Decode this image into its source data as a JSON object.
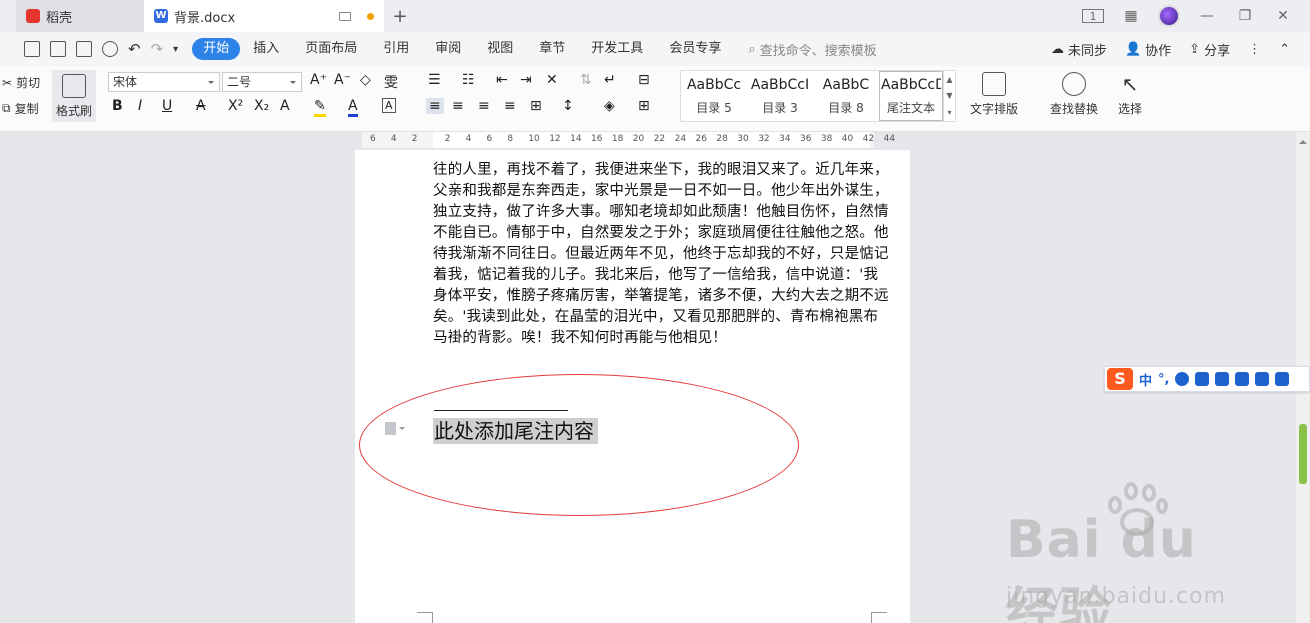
{
  "titlebar": {
    "tabs": [
      {
        "label": "稻壳",
        "active": false
      },
      {
        "label": "背景.docx",
        "active": true
      }
    ],
    "page_indicator": "1"
  },
  "menubar": {
    "items": [
      "开始",
      "插入",
      "页面布局",
      "引用",
      "审阅",
      "视图",
      "章节",
      "开发工具",
      "会员专享"
    ],
    "active": "开始",
    "search_placeholder": "查找命令、搜索模板",
    "right": [
      "未同步",
      "协作",
      "分享"
    ]
  },
  "ribbon": {
    "cut": "剪切",
    "copy": "复制",
    "format_painter": "格式刷",
    "font_name": "宋体",
    "font_size": "二号",
    "styles": [
      {
        "sample": "AaBbCc",
        "name": "目录 5"
      },
      {
        "sample": "AaBbCcI",
        "name": "目录 3"
      },
      {
        "sample": "AaBbC",
        "name": "目录 8"
      },
      {
        "sample": "AaBbCcDd",
        "name": "尾注文本"
      }
    ],
    "text_layout": "文字排版",
    "find_replace": "查找替换",
    "select": "选择"
  },
  "ruler": {
    "ticks": [
      "6",
      "4",
      "2",
      "2",
      "4",
      "6",
      "8",
      "10",
      "12",
      "14",
      "16",
      "18",
      "20",
      "22",
      "24",
      "26",
      "28",
      "30",
      "32",
      "34",
      "36",
      "38",
      "40",
      "42",
      "44"
    ]
  },
  "document": {
    "lines": [
      "往的人里，再找不着了，我便进来坐下，我的眼泪又来了。近几年来，",
      "父亲和我都是东奔西走，家中光景是一日不如一日。他少年出外谋生，",
      "独立支持，做了许多大事。哪知老境却如此颓唐！他触目伤怀，自然情",
      "不能自已。情郁于中，自然要发之于外；家庭琐屑便往往触他之怒。他",
      "待我渐渐不同往日。但最近两年不见，他终于忘却我的不好，只是惦记",
      "着我，惦记着我的儿子。我北来后，他写了一信给我，信中说道：'我",
      "身体平安，惟膀子疼痛厉害，举箸提笔，诸多不便，大约大去之期不远",
      "矣。'我读到此处，在晶莹的泪光中，又看见那肥胖的、青布棉袍黑布",
      "马褂的背影。唉！我不知何时再能与他相见！"
    ],
    "endnote_text": "此处添加尾注内容"
  },
  "ime": {
    "lang": "中",
    "punct": "°,"
  },
  "watermark": {
    "main": "Bai du 经验",
    "sub": "jingyan.baidu.com"
  },
  "colors": {
    "accent": "#2d83e8",
    "highlight_ellipse": "#e33a3a"
  }
}
